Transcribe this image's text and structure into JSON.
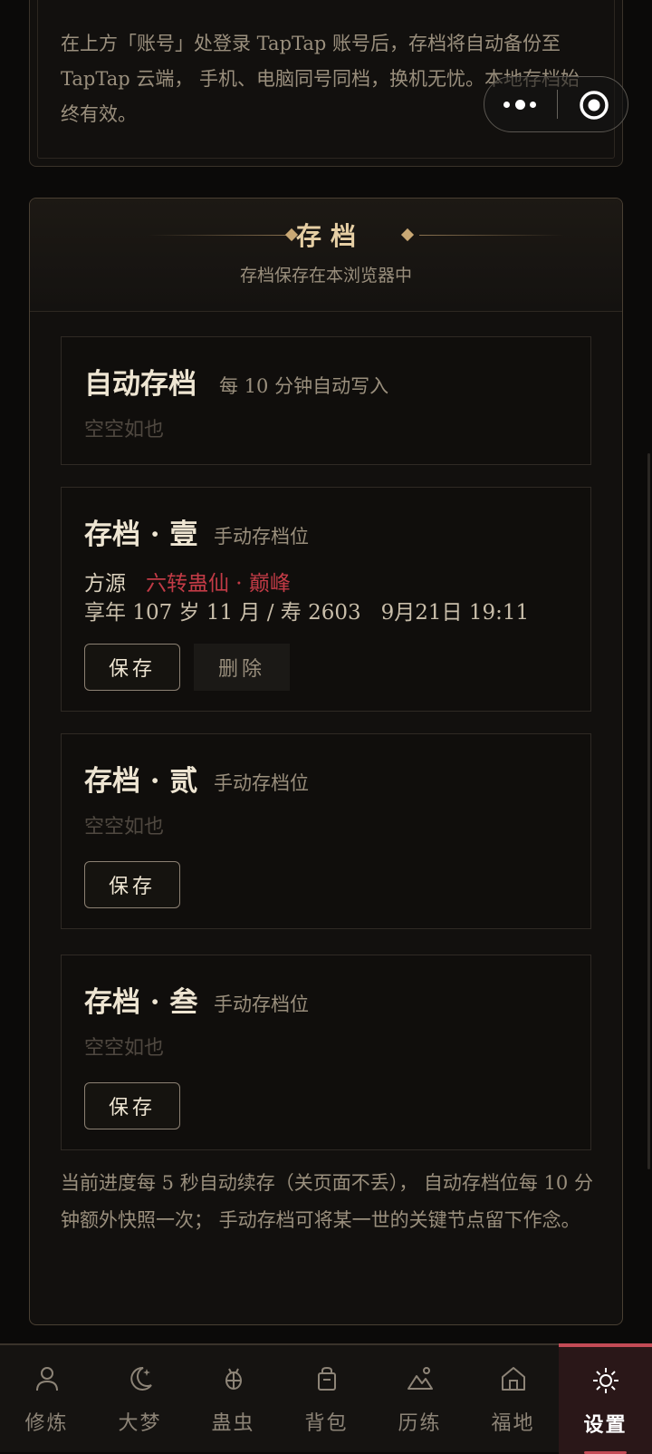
{
  "account_notice": {
    "text": "在上方「账号」处登录 TapTap 账号后，存档将自动备份至 TapTap 云端， 手机、电脑同号同档，换机无忧。本地存档始终有效。"
  },
  "save_panel": {
    "title": "存档",
    "subtitle": "存档保存在本浏览器中"
  },
  "auto_slot": {
    "title": "自动存档",
    "note": "每 10 分钟自动写入",
    "empty": "空空如也"
  },
  "slots": [
    {
      "title": "存档 · 壹",
      "note": "手动存档位",
      "label": "方源",
      "rank": "六转蛊仙 · 巅峰",
      "age_info": "享年 107 岁 11 月 / 寿 2603",
      "timestamp": "9月21日 19:11",
      "save_label": "保存",
      "delete_label": "删除"
    },
    {
      "title": "存档 · 贰",
      "note": "手动存档位",
      "empty": "空空如也",
      "save_label": "保存"
    },
    {
      "title": "存档 · 叁",
      "note": "手动存档位",
      "empty": "空空如也",
      "save_label": "保存"
    }
  ],
  "footer_note": "当前进度每 5 秒自动续存（关页面不丢）， 自动存档位每 10 分钟额外快照一次； 手动存档可将某一世的关键节点留下作念。",
  "tabs": [
    {
      "label": "修炼",
      "icon": "person-icon"
    },
    {
      "label": "大梦",
      "icon": "moon-icon"
    },
    {
      "label": "蛊虫",
      "icon": "bug-icon"
    },
    {
      "label": "背包",
      "icon": "bag-icon"
    },
    {
      "label": "历练",
      "icon": "mountain-icon"
    },
    {
      "label": "福地",
      "icon": "home-icon"
    },
    {
      "label": "设置",
      "icon": "gear-icon",
      "active": true
    }
  ],
  "colors": {
    "accent_red": "#c44b56",
    "rank_red": "#c23b46",
    "gold": "#e6cfa4",
    "background": "#0b0a09"
  }
}
